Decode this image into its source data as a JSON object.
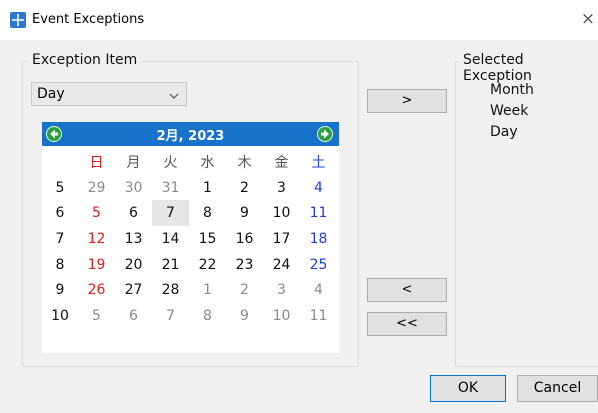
{
  "window": {
    "title": "Event Exceptions",
    "close": "×"
  },
  "exception_item": {
    "group_title": "Exception Item",
    "dropdown_value": "Day"
  },
  "calendar": {
    "title": "2月, 2023",
    "weekday_headers": [
      "日",
      "月",
      "火",
      "水",
      "木",
      "金",
      "土"
    ],
    "weeks": [
      {
        "week": "5",
        "days": [
          "29",
          "30",
          "31",
          "1",
          "2",
          "3",
          "4"
        ]
      },
      {
        "week": "6",
        "days": [
          "5",
          "6",
          "7",
          "8",
          "9",
          "10",
          "11"
        ]
      },
      {
        "week": "7",
        "days": [
          "12",
          "13",
          "14",
          "15",
          "16",
          "17",
          "18"
        ]
      },
      {
        "week": "8",
        "days": [
          "19",
          "20",
          "21",
          "22",
          "23",
          "24",
          "25"
        ]
      },
      {
        "week": "9",
        "days": [
          "26",
          "27",
          "28",
          "1",
          "2",
          "3",
          "4"
        ]
      },
      {
        "week": "10",
        "days": [
          "5",
          "6",
          "7",
          "8",
          "9",
          "10",
          "11"
        ]
      }
    ],
    "selected_day": "7",
    "accent_color": "#1773c9"
  },
  "buttons": {
    "add": ">",
    "remove": "<",
    "remove_all": "<<",
    "ok": "OK",
    "cancel": "Cancel"
  },
  "selected_exception": {
    "group_title": "Selected Exception",
    "items": [
      "Month",
      "Week",
      "Day"
    ]
  }
}
